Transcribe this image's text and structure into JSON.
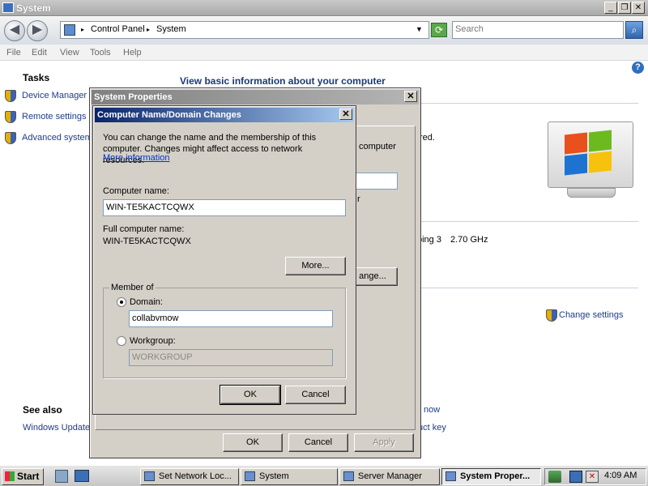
{
  "window": {
    "title": "System"
  },
  "address": {
    "segments": [
      "Control Panel",
      "System"
    ],
    "search_placeholder": "Search"
  },
  "menu": [
    "File",
    "Edit",
    "View",
    "Tools",
    "Help"
  ],
  "tasks": {
    "heading": "Tasks",
    "items": [
      "Device Manager",
      "Remote settings",
      "Advanced system"
    ]
  },
  "main": {
    "heading": "View basic information about your computer",
    "frag_red": "red.",
    "frag_ping": "ping 3",
    "frag_ghz": "2.70 GHz",
    "change_settings": "Change settings",
    "frag_now": "now",
    "frag_key": "uct key"
  },
  "see_also": {
    "heading": "See also",
    "items": [
      "Windows Update"
    ]
  },
  "sysprops": {
    "title": "System Properties",
    "frag_computer": "computer",
    "frag_r": "r",
    "frag_change": "ange...",
    "ok": "OK",
    "cancel": "Cancel",
    "apply": "Apply"
  },
  "namechange": {
    "title": "Computer Name/Domain Changes",
    "intro": "You can change the name and the membership of this computer. Changes might affect access to network resources.",
    "more_info": "More information",
    "computer_name_label": "Computer name:",
    "computer_name": "WIN-TE5KACTCQWX",
    "full_name_label": "Full computer name:",
    "full_name": "WIN-TE5KACTCQWX",
    "more": "More...",
    "member_of": "Member of",
    "domain_label": "Domain:",
    "domain": "collabvmow",
    "workgroup_label": "Workgroup:",
    "workgroup": "WORKGROUP",
    "ok": "OK",
    "cancel": "Cancel"
  },
  "taskbar": {
    "start": "Start",
    "buttons": [
      "Set Network Loc...",
      "System",
      "Server Manager",
      "System Proper..."
    ],
    "clock": "4:09 AM"
  },
  "colors": {
    "link": "#1f3c88",
    "title_active": "#0a246a",
    "title_inactive": "#808080"
  }
}
